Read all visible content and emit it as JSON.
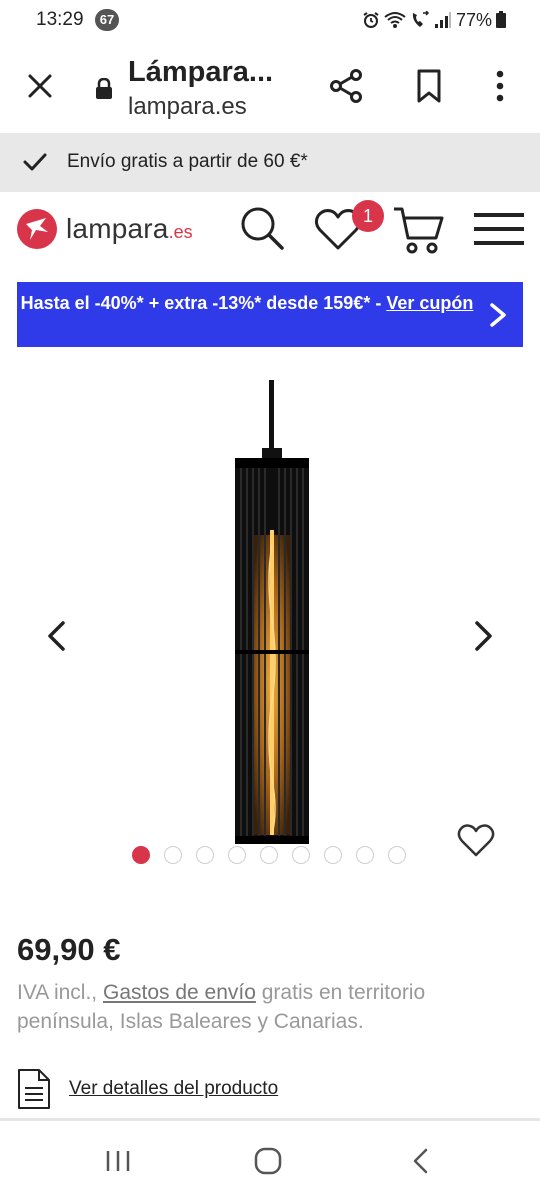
{
  "status_bar": {
    "time": "13:29",
    "notification_count": "67",
    "battery": "77%"
  },
  "browser": {
    "title": "Lámpara...",
    "url": "lampara.es"
  },
  "shipping_banner": {
    "text": "Envío gratis a partir de 60 €*"
  },
  "header": {
    "logo_text": "lampara",
    "logo_tld": ".es",
    "wishlist_count": "1"
  },
  "promo": {
    "text": "Hasta el -40%* + extra -13%* desde 159€* - ",
    "link_text": "Ver cupón"
  },
  "gallery": {
    "image_count": 9,
    "active_index": 0
  },
  "product": {
    "price": "69,90 €",
    "tax_prefix": "IVA incl., ",
    "shipping_link": "Gastos de envío",
    "tax_suffix": " gratis en territorio península, Islas Baleares y Canarias.",
    "details_link": "Ver detalles del producto"
  },
  "colors": {
    "brand": "#d9354a",
    "promo_bg": "#2f3be8"
  }
}
